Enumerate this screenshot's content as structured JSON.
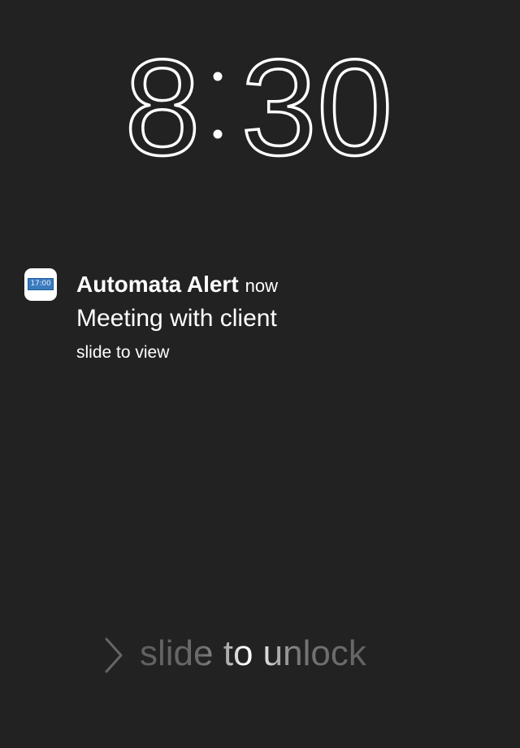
{
  "lock_screen": {
    "clock": {
      "hour": "8",
      "minutes": "30"
    },
    "notification": {
      "app_icon_label": "17:00",
      "app_name": "Automata Alert",
      "time_ago": "now",
      "message": "Meeting with client",
      "action_hint": "slide to view"
    },
    "unlock": {
      "label": "slide to unlock",
      "icon": "chevron-right-icon"
    }
  },
  "colors": {
    "background": "#222222",
    "text": "#ffffff",
    "muted": "#666666",
    "calendar_icon": "#3a7bbf"
  }
}
